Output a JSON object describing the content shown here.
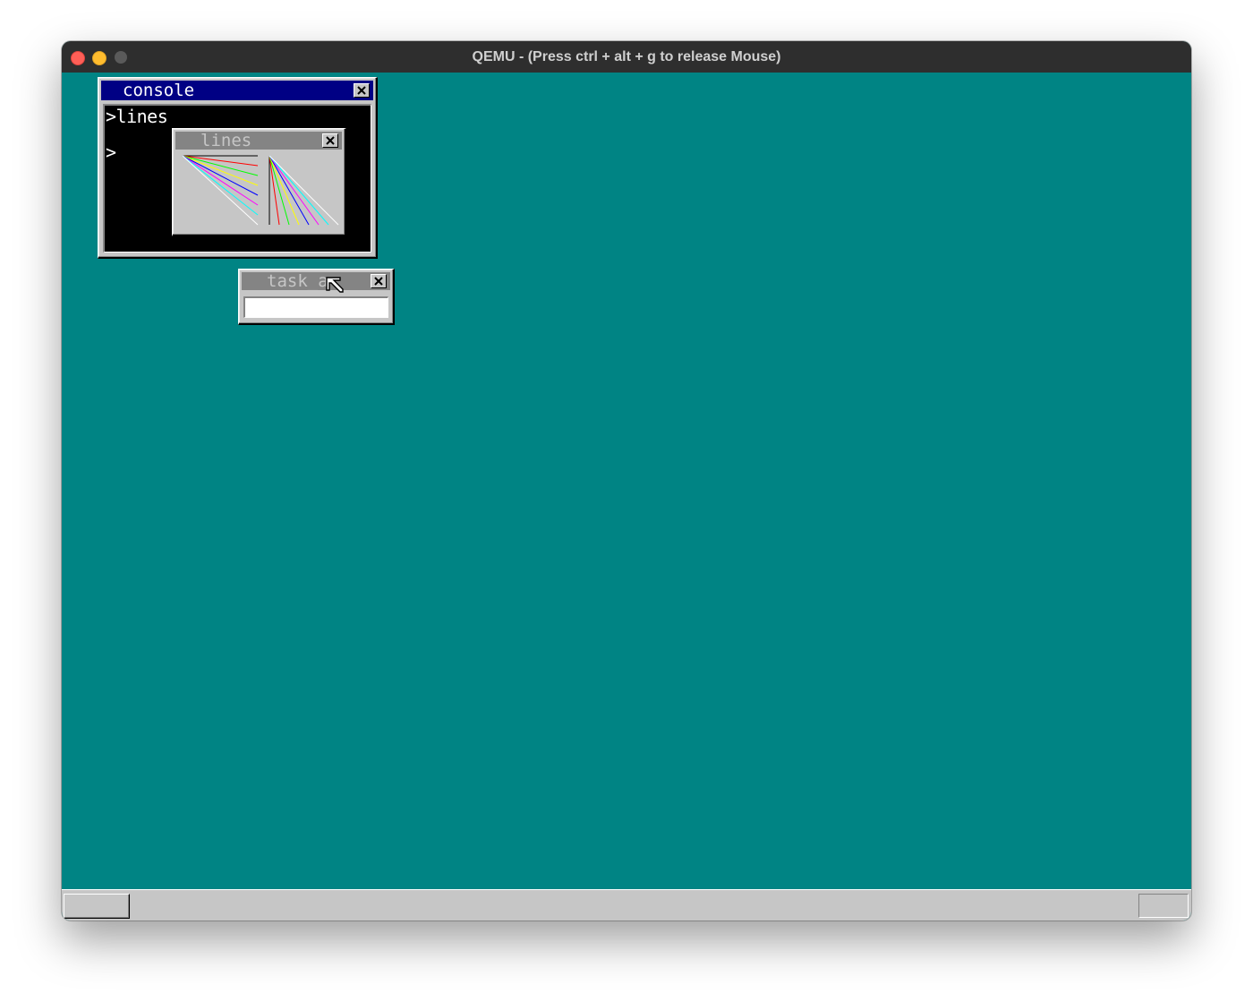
{
  "window": {
    "title": "QEMU - (Press ctrl + alt + g to release Mouse)"
  },
  "desktop": {
    "background_color": "#008484"
  },
  "console": {
    "title": "console",
    "lines": [
      ">lines",
      ">"
    ]
  },
  "lines_window": {
    "title": "lines",
    "line_colors": [
      "#000000",
      "#ff0000",
      "#00ff00",
      "#ffff00",
      "#0000ff",
      "#ff00ff",
      "#00ffff",
      "#ffffff"
    ]
  },
  "task_a": {
    "title": "task_a",
    "input_value": ""
  },
  "icons": {
    "close": "close-x-icon",
    "cursor": "mouse-pointer-icon"
  }
}
